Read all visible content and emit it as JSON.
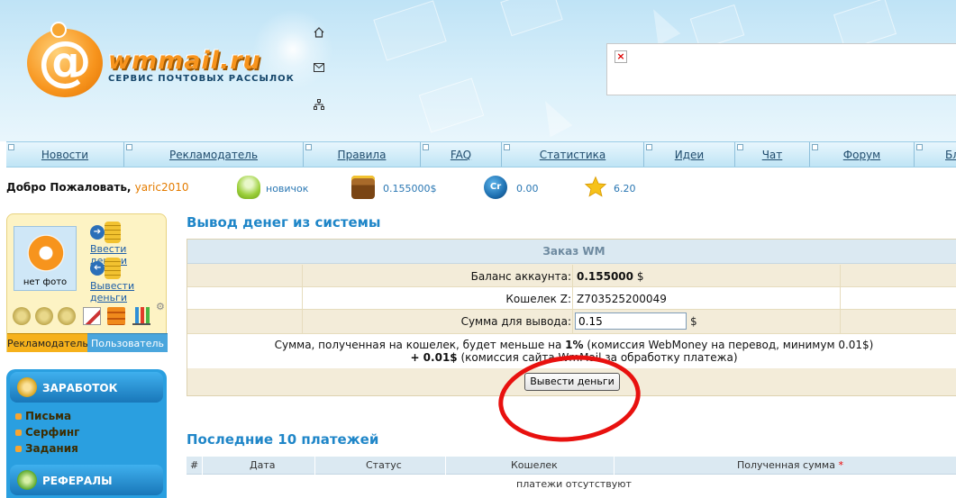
{
  "header": {
    "logo_symbol": "@",
    "logo_text": "wmmail.ru",
    "logo_sub": "СЕРВИС ПОЧТОВЫХ РАССЫЛОК",
    "icons": [
      "home-icon",
      "mail-icon",
      "sitemap-icon"
    ]
  },
  "nav": {
    "items": [
      "Новости",
      "Рекламодатель",
      "Правила",
      "FAQ",
      "Статистика",
      "Идеи",
      "Чат",
      "Форум",
      "Бл"
    ]
  },
  "welcome": {
    "greeting": "Добро Пожаловать,",
    "username": "yaric2010",
    "status": "новичок",
    "balance": "0.155000$",
    "credits": "0.00",
    "rating": "6.20"
  },
  "profile": {
    "avatar_caption": "нет фото",
    "deposit_link": "Ввести деньги",
    "withdraw_link": "Вывести деньги",
    "tab_advertiser": "Рекламодатель",
    "tab_user": "Пользователь"
  },
  "menu": {
    "earnings_title": "ЗАРАБОТОК",
    "earnings_items": [
      "Письма",
      "Серфинг",
      "Задания"
    ],
    "referrals_title": "РЕФЕРАЛЫ"
  },
  "withdraw": {
    "page_title": "Вывод денег из системы",
    "panel_title": "Заказ WM",
    "balance_label": "Баланс аккаунта:",
    "balance_value": "0.155000",
    "currency": "$",
    "wallet_label": "Кошелек Z:",
    "wallet_value": "Z703525200049",
    "amount_label": "Сумма для вывода:",
    "amount_value": "0.15",
    "note_line1_a": "Сумма, полученная на кошелек, будет меньше на ",
    "note_line1_pct": "1%",
    "note_line1_b": " (комиссия WebMoney на перевод, минимум 0.01$)",
    "note_line2_a": "+ 0.01$",
    "note_line2_b": " (комиссия сайта WmMail за обработку платежа)",
    "button_label": "Вывести деньги"
  },
  "payments": {
    "title": "Последние 10 платежей",
    "columns": [
      "#",
      "Дата",
      "Статус",
      "Кошелек",
      "Полученная сумма"
    ],
    "required_mark": "*",
    "empty_text": "платежи отсутствуют"
  },
  "colors": {
    "accent_blue": "#1f86c8",
    "logo_orange": "#f7941d",
    "annotation_red": "#e8110f"
  }
}
